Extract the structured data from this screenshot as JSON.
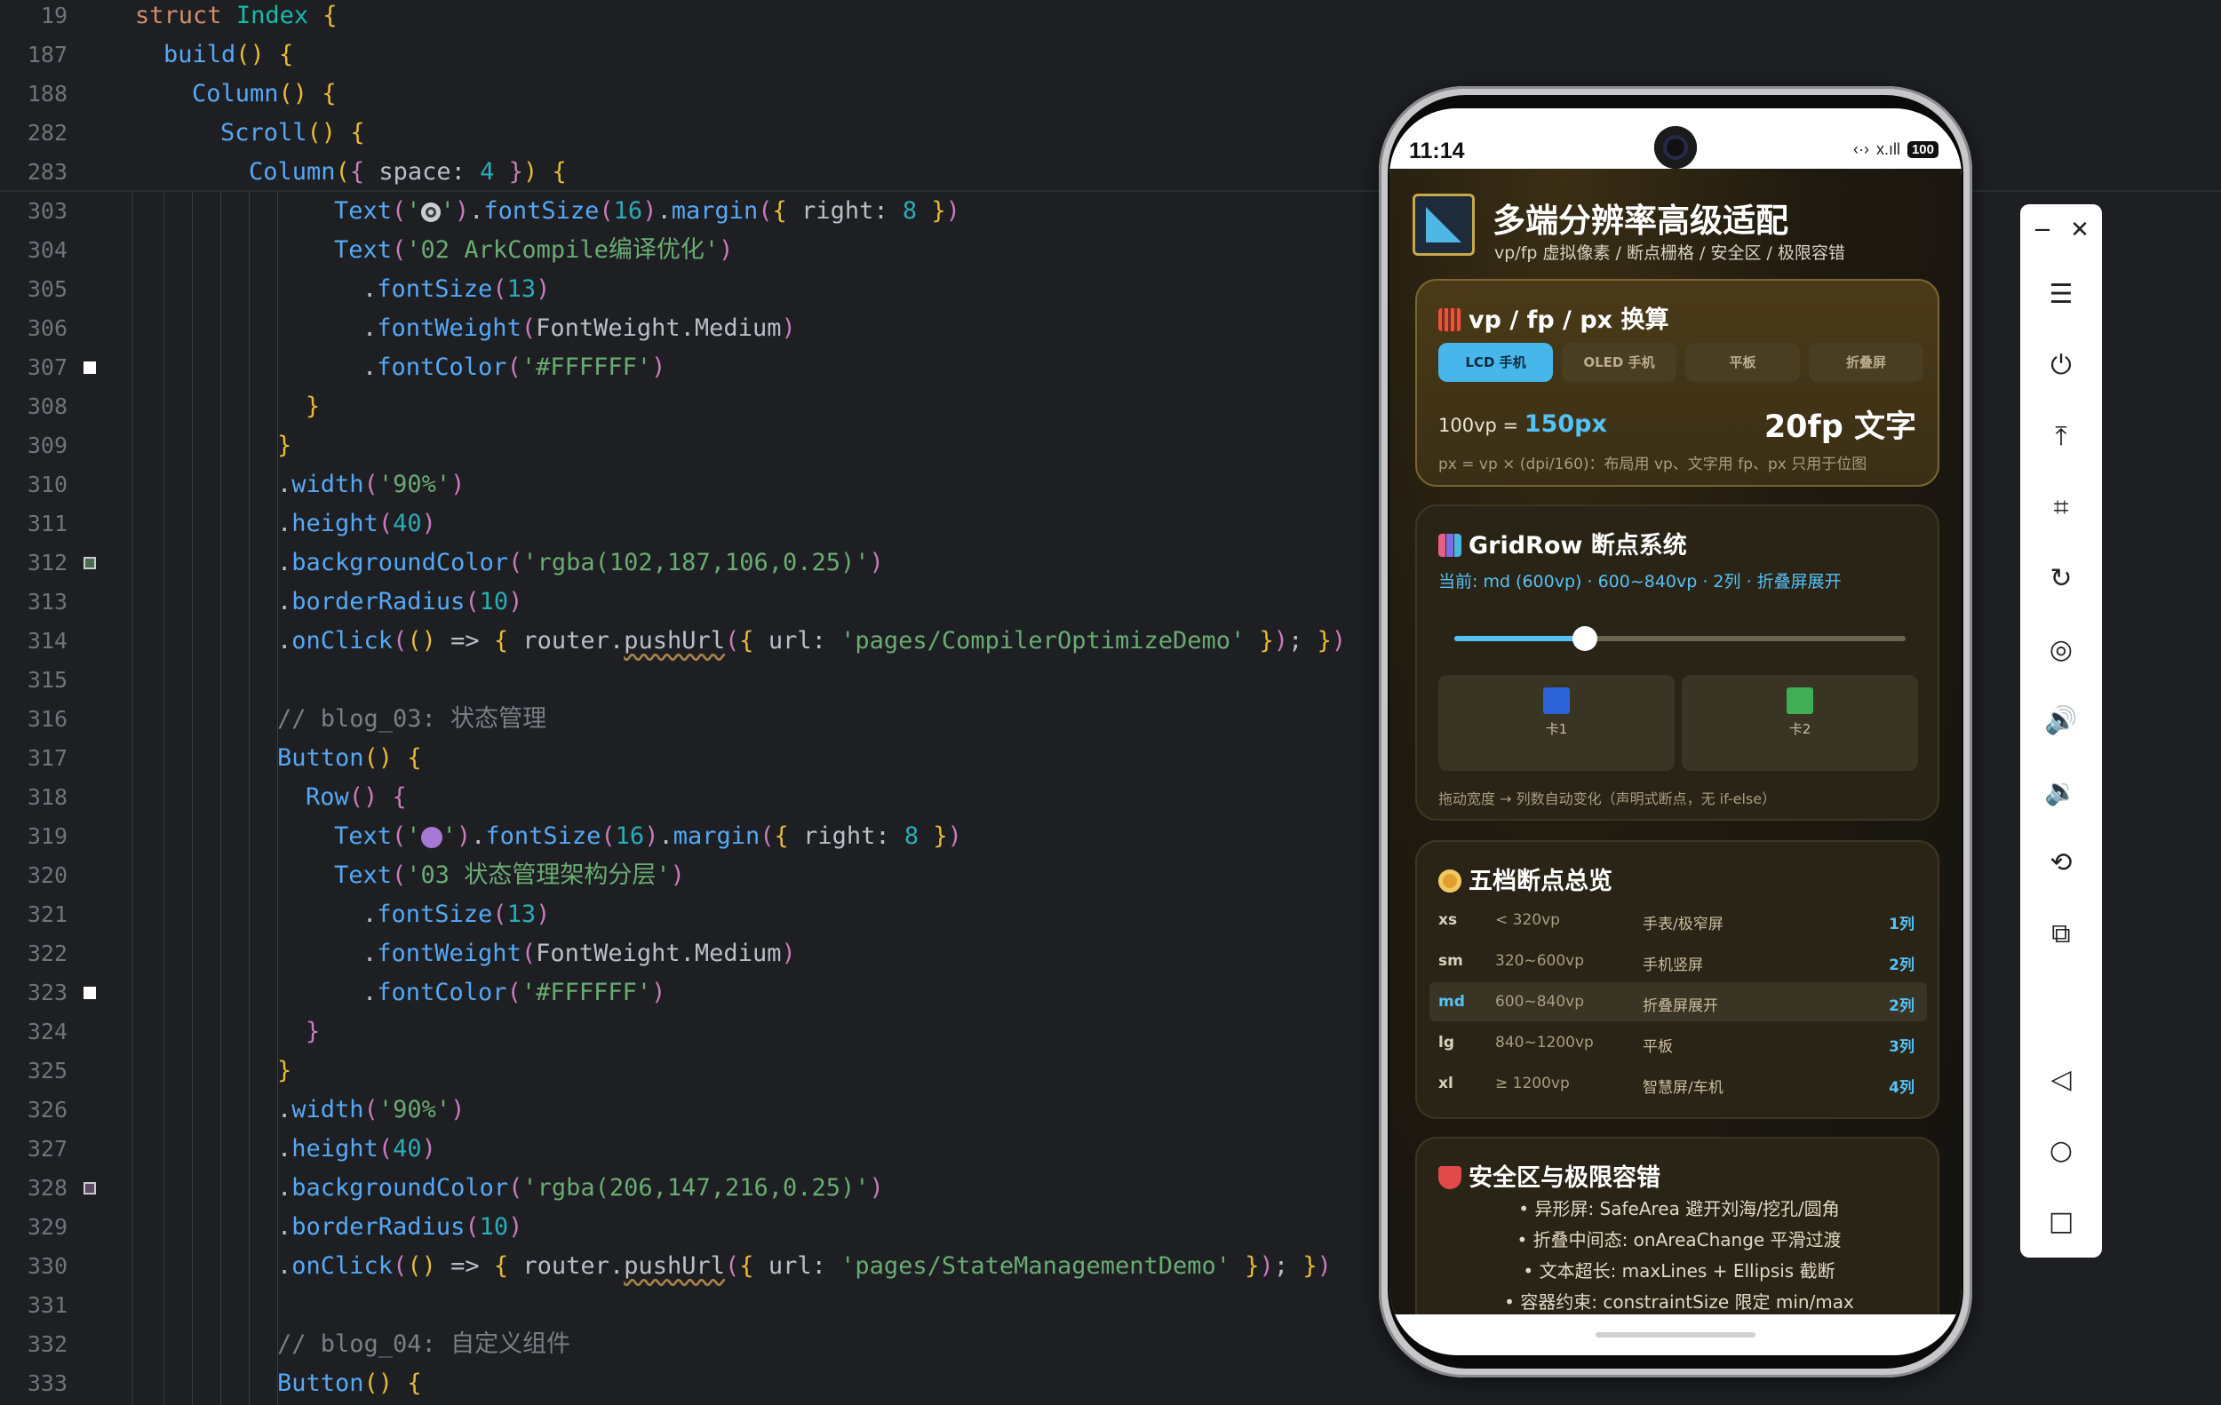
{
  "editor": {
    "sticky": [
      {
        "num": "19",
        "html_key": "s19"
      },
      {
        "num": "187",
        "html_key": "s187"
      },
      {
        "num": "188",
        "html_key": "s188"
      },
      {
        "num": "282",
        "html_key": "s282"
      },
      {
        "num": "283",
        "html_key": "s283"
      }
    ],
    "line_numbers": [
      "303",
      "304",
      "305",
      "306",
      "307",
      "308",
      "309",
      "310",
      "311",
      "312",
      "313",
      "314",
      "315",
      "316",
      "317",
      "318",
      "319",
      "320",
      "321",
      "322",
      "323",
      "324",
      "325",
      "326",
      "327",
      "328",
      "329",
      "330",
      "331",
      "332",
      "333"
    ],
    "sticky_numbers": [
      "19",
      "187",
      "188",
      "282",
      "283"
    ],
    "tokens": {
      "struct": "struct",
      "index": "Index",
      "brace_open": " {",
      "build": "build",
      "paren": "()",
      "column": "Column",
      "scroll": "Scroll",
      "space_key": "space",
      "four": "4",
      "text_fn": "Text",
      "fontsize_fn": "fontSize",
      "margin_fn": "margin",
      "right_key": "right",
      "eight": "8",
      "str_02": "'02 ArkCompile编译优化'",
      "n13": "13",
      "fontweight_fn": "fontWeight",
      "fw_enum": "FontWeight",
      "fw_medium": "Medium",
      "fontcolor_fn": "fontColor",
      "white": "'#FFFFFF'",
      "width_fn": "width",
      "w90": "'90%'",
      "height_fn": "height",
      "h40": "40",
      "bg_fn": "backgroundColor",
      "bg_green": "'rgba(102,187,106,0.25)'",
      "bg_purple": "'rgba(206,147,216,0.25)'",
      "radius_fn": "borderRadius",
      "r10": "10",
      "onclick_fn": "onClick",
      "router": "router",
      "pushurl": "pushUrl",
      "url_key": "url",
      "url1": "'pages/CompilerOptimizeDemo'",
      "url2": "'pages/StateManagementDemo'",
      "comment_03": "// blog_03: 状态管理",
      "comment_04": "// blog_04: 自定义组件",
      "button": "Button",
      "row": "Row",
      "str_03": "'03 状态管理架构分层'",
      "n16": "16"
    }
  },
  "phone": {
    "status": {
      "time": "11:14",
      "battery": "100",
      "net": "‹·›",
      "signal": "x.ıll"
    },
    "header": {
      "title": "多端分辨率高级适配",
      "subtitle": "vp/fp 虚拟像素 / 断点栅格 / 安全区 / 极限容错"
    },
    "convert": {
      "title": "vp / fp / px 换算",
      "tabs": [
        "LCD 手机",
        "OLED 手机",
        "平板",
        "折叠屏"
      ],
      "active_tab": 0,
      "left_prefix": "100vp = ",
      "left_value": "150px",
      "right": "20fp 文字",
      "note": "px = vp × (dpi/160)：布局用 vp、文字用 fp、px 只用于位图"
    },
    "gridrow": {
      "title": "GridRow 断点系统",
      "info": "当前: md (600vp) · 600~840vp · 2列 · 折叠屏展开",
      "slider_fraction": 0.29,
      "cells": [
        {
          "label": "卡1",
          "color": "#2c63d6"
        },
        {
          "label": "卡2",
          "color": "#3fae55"
        }
      ],
      "note": "拖动宽度 → 列数自动变化（声明式断点，无 if-else）"
    },
    "breakpoints": {
      "title": "五档断点总览",
      "rows": [
        {
          "k": "xs",
          "range": "< 320vp",
          "device": "手表/极窄屏",
          "cols": "1列",
          "hl": false
        },
        {
          "k": "sm",
          "range": "320~600vp",
          "device": "手机竖屏",
          "cols": "2列",
          "hl": false
        },
        {
          "k": "md",
          "range": "600~840vp",
          "device": "折叠屏展开",
          "cols": "2列",
          "hl": true
        },
        {
          "k": "lg",
          "range": "840~1200vp",
          "device": "平板",
          "cols": "3列",
          "hl": false
        },
        {
          "k": "xl",
          "range": "≥ 1200vp",
          "device": "智慧屏/车机",
          "cols": "4列",
          "hl": false
        }
      ]
    },
    "safe": {
      "title": "安全区与极限容错",
      "bullets": [
        "• 异形屏: SafeArea 避开刘海/挖孔/圆角",
        "• 折叠中间态: onAreaChange 平滑过渡",
        "• 文本超长: maxLines + Ellipsis 截断",
        "• 容器约束: constraintSize 限定 min/max"
      ]
    }
  },
  "toolbar": {
    "minimize": "−",
    "close": "✕",
    "buttons": [
      {
        "name": "menu-icon",
        "glyph": "☰"
      },
      {
        "name": "power-icon",
        "glyph": "⏻"
      },
      {
        "name": "to-top-icon",
        "glyph": "⤒"
      },
      {
        "name": "crop-icon",
        "glyph": "⌗"
      },
      {
        "name": "rotate-icon",
        "glyph": "↻"
      },
      {
        "name": "screenshot-icon",
        "glyph": "◎"
      },
      {
        "name": "volume-up-icon",
        "glyph": "🔊"
      },
      {
        "name": "volume-down-icon",
        "glyph": "🔉"
      },
      {
        "name": "shake-icon",
        "glyph": "⟲"
      },
      {
        "name": "multi-device-icon",
        "glyph": "⧉"
      },
      {
        "name": "back-icon",
        "glyph": "◁"
      },
      {
        "name": "home-icon",
        "glyph": "○"
      },
      {
        "name": "recent-apps-icon",
        "glyph": "□"
      }
    ]
  },
  "colors": {
    "accent": "#55c2f5",
    "editor_bg": "#1e1f22",
    "card_gold": "#7a6430"
  }
}
